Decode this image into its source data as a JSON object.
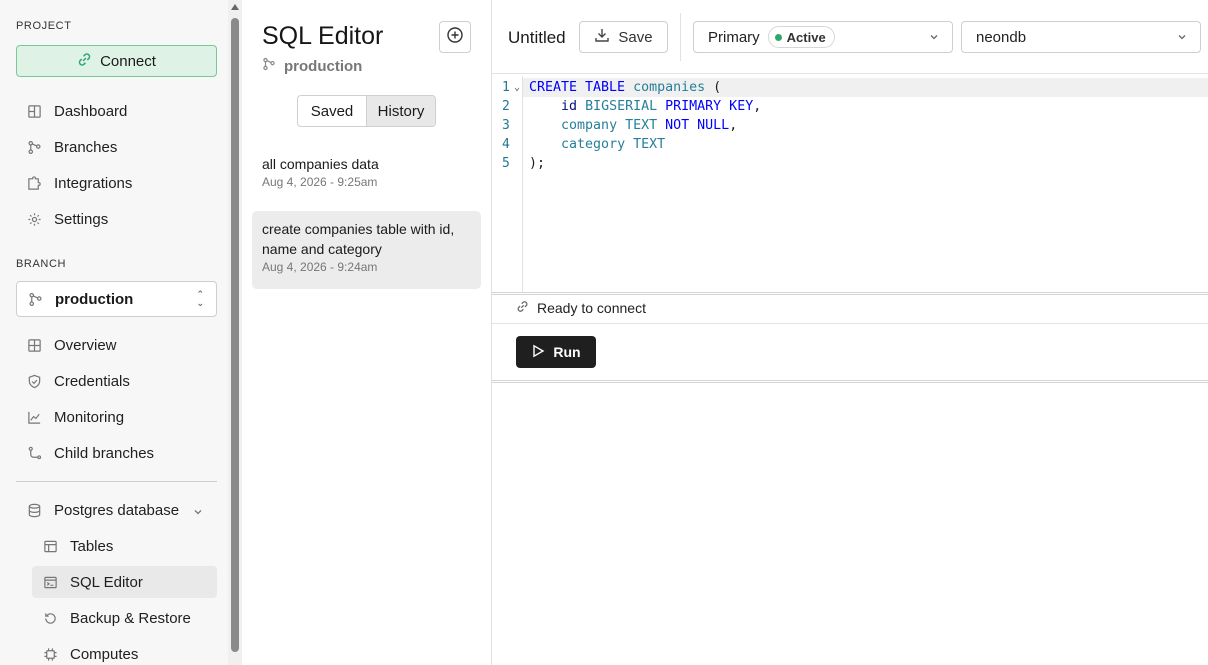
{
  "sidebar": {
    "project_label": "PROJECT",
    "connect_label": "Connect",
    "project_items": [
      {
        "label": "Dashboard",
        "icon": "grid-icon"
      },
      {
        "label": "Branches",
        "icon": "branch-icon"
      },
      {
        "label": "Integrations",
        "icon": "puzzle-icon"
      },
      {
        "label": "Settings",
        "icon": "gear-icon"
      }
    ],
    "branch_label": "BRANCH",
    "branch_value": "production",
    "branch_items": [
      {
        "label": "Overview",
        "icon": "grid-icon"
      },
      {
        "label": "Credentials",
        "icon": "shield-icon"
      },
      {
        "label": "Monitoring",
        "icon": "chart-icon"
      },
      {
        "label": "Child branches",
        "icon": "child-branch-icon"
      }
    ],
    "database_group": "Postgres database",
    "database_items": [
      {
        "label": "Tables",
        "icon": "table-icon"
      },
      {
        "label": "SQL Editor",
        "icon": "terminal-icon",
        "active": true
      },
      {
        "label": "Backup & Restore",
        "icon": "restore-icon"
      },
      {
        "label": "Computes",
        "icon": "chip-icon"
      }
    ]
  },
  "panel": {
    "title": "SQL Editor",
    "branch": "production",
    "tabs": [
      "Saved",
      "History"
    ],
    "active_tab": "History",
    "history": [
      {
        "title": "all companies data",
        "date": "Aug 4, 2026 - 9:25am"
      },
      {
        "title": "create companies table with id, name and category",
        "date": "Aug 4, 2026 - 9:24am"
      }
    ]
  },
  "editor": {
    "doc_name": "Untitled",
    "save_label": "Save",
    "compute": "Primary",
    "compute_status": "Active",
    "database": "neondb",
    "lines": [
      "1",
      "2",
      "3",
      "4",
      "5"
    ],
    "status": "Ready to connect",
    "run_label": "Run"
  },
  "colors": {
    "accent_green": "#2ea86c",
    "connect_bg": "#dff2e6",
    "run_bg": "#1f1f1f",
    "keyword": "#0000ff",
    "type": "#267f99"
  }
}
